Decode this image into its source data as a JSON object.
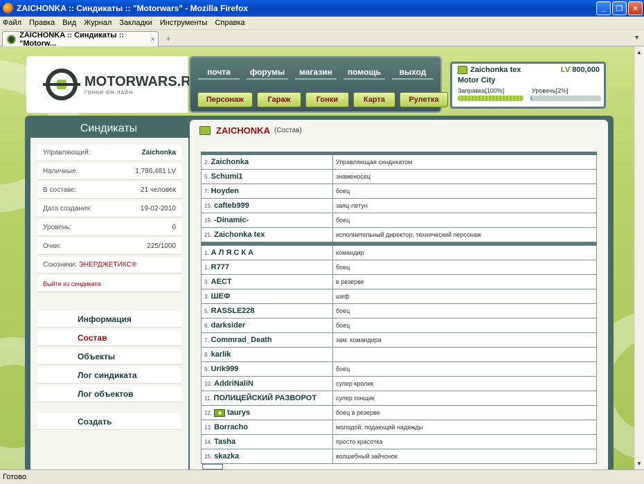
{
  "window": {
    "title": "ZAICHONKA :: Синдикаты :: \"Motorwars\" - Mozilla Firefox",
    "minimize": "_",
    "maximize": "❐",
    "close": "✕"
  },
  "menubar": [
    "Файл",
    "Правка",
    "Вид",
    "Журнал",
    "Закладки",
    "Инструменты",
    "Справка"
  ],
  "tab": {
    "label": "ZAICHONKA :: Синдикаты :: \"Motorw...",
    "close": "×"
  },
  "statusbar": {
    "text": "Готово"
  },
  "site": {
    "logo": "MOTORWARS.RU",
    "logo_sub": "ГОНКИ ОН-ЛАЙН",
    "nav_top": [
      "почта",
      "форумы",
      "магазин",
      "помощь",
      "выход"
    ],
    "nav_buttons": [
      "Персонаж",
      "Гараж",
      "Гонки",
      "Карта",
      "Рулетка"
    ],
    "user": {
      "name": "Zaichonka tex",
      "lv_label": "LV",
      "lv_value": "800,000",
      "city": "Motor City",
      "fuel_label": "Заправка[100%]",
      "fuel_percent": 100,
      "level_label": "Уровень[2%]",
      "level_percent": 2
    }
  },
  "left": {
    "heading": "Синдикаты",
    "info": [
      {
        "label": "Управляющий:",
        "value": "Zaichonka",
        "style": "bold"
      },
      {
        "label": "Наличные:",
        "value": "1,786,481 LV"
      },
      {
        "label": "В составе:",
        "value": "21 человек"
      },
      {
        "label": "Дата создания:",
        "value": "19-02-2010"
      },
      {
        "label": "Уровень:",
        "value": "0"
      },
      {
        "label": "Очки:",
        "value": "225/1000"
      }
    ],
    "allies_label": "Союзники:",
    "allies_value": "ЭНЕРДЖЕТИКС®",
    "leave": "Выйти из синдиката",
    "menu": [
      "Информация",
      "Состав",
      "Объекты",
      "Лог синдиката",
      "Лог объектов"
    ],
    "create": "Создать"
  },
  "right": {
    "title": "ZAICHONKA",
    "subtitle": "(Состав)",
    "leaders": [
      {
        "num": "2.",
        "name": "Zaichonka",
        "role": "Управляющая синдикатом"
      },
      {
        "num": "5.",
        "name": "Schumi1",
        "role": "знаменосец"
      },
      {
        "num": "7.",
        "name": "Hoyden",
        "role": "боец"
      },
      {
        "num": "15.",
        "name": "cafteb999",
        "role": "заяц-летун"
      },
      {
        "num": "19.",
        "name": "-Dinamic-",
        "role": "боец"
      },
      {
        "num": "21.",
        "name": "Zaichonka tex",
        "role": "исполнительный директор, технический персонаж"
      }
    ],
    "members": [
      {
        "num": "1.",
        "name": "А Л Я С К А",
        "role": "командир"
      },
      {
        "num": "1.",
        "name": "R777",
        "role": "боец"
      },
      {
        "num": "3.",
        "name": "AECT",
        "role": "в резерве"
      },
      {
        "num": "3.",
        "name": "ШЕФ",
        "role": "шеф"
      },
      {
        "num": "5.",
        "name": "RASSLE228",
        "role": "боец"
      },
      {
        "num": "6.",
        "name": "darksider",
        "role": "боец"
      },
      {
        "num": "7.",
        "name": "Commrad_Death",
        "role": "зам. командира"
      },
      {
        "num": "8.",
        "name": "karlik",
        "role": ""
      },
      {
        "num": "9.",
        "name": "Urik999",
        "role": "боец"
      },
      {
        "num": "10.",
        "name": "AddriNaliN",
        "role": "супер кролик"
      },
      {
        "num": "11.",
        "name": "ПОЛИЦЕЙСКИЙ РАЗВОРОТ",
        "role": "супер гонщик"
      },
      {
        "num": "12.",
        "name": "taurys",
        "role": "боец в резерве",
        "flag": true
      },
      {
        "num": "13.",
        "name": "Borracho",
        "role": "молодой, подающий надежды"
      },
      {
        "num": "14.",
        "name": "Tasha",
        "role": "просто красотка"
      },
      {
        "num": "15.",
        "name": "skazka",
        "role": "волшебный зайчонок"
      }
    ]
  }
}
